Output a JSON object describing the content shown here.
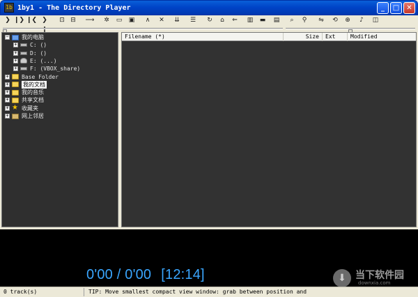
{
  "window": {
    "app_icon_text": "1b",
    "title": "1by1 - The Directory Player",
    "minimize": "_",
    "maximize": "□",
    "close": "✕"
  },
  "toolbar": {
    "buttons": [
      {
        "name": "play-icon",
        "glyph": "❯"
      },
      {
        "name": "play-pause-icon",
        "glyph": "❙❯"
      },
      {
        "name": "previous-icon",
        "glyph": "❙❮"
      },
      {
        "name": "next-icon",
        "glyph": "❯❙"
      },
      {
        "name": "open-file-icon",
        "glyph": "⊡"
      },
      {
        "name": "open-folder-icon",
        "glyph": "⊟"
      },
      {
        "name": "goto-icon",
        "glyph": "⟶"
      },
      {
        "name": "settings-icon",
        "glyph": "✲"
      },
      {
        "name": "view-compact-icon",
        "glyph": "▭"
      },
      {
        "name": "view-large-icon",
        "glyph": "▣"
      },
      {
        "name": "up-icon",
        "glyph": "∧"
      },
      {
        "name": "close-x-icon",
        "glyph": "✕"
      },
      {
        "name": "sort-icon",
        "glyph": "⇊"
      },
      {
        "name": "list-icon",
        "glyph": "☰"
      },
      {
        "name": "refresh-icon",
        "glyph": "↻"
      },
      {
        "name": "home-icon",
        "glyph": "⌂"
      },
      {
        "name": "back-icon",
        "glyph": "⇐"
      },
      {
        "name": "bookmark-icon",
        "glyph": "▥"
      },
      {
        "name": "bar-icon",
        "glyph": "▬"
      },
      {
        "name": "folder-icon",
        "glyph": "▤"
      },
      {
        "name": "search-icon",
        "glyph": "⌕"
      },
      {
        "name": "find-icon",
        "glyph": "⚲"
      },
      {
        "name": "equalizer-icon",
        "glyph": "⇋"
      },
      {
        "name": "loop-icon",
        "glyph": "⟲"
      },
      {
        "name": "download-icon",
        "glyph": "⊕"
      },
      {
        "name": "volume-icon",
        "glyph": "♪"
      },
      {
        "name": "panel-icon",
        "glyph": "◫"
      }
    ]
  },
  "sliders": {
    "seek_position": 0.0,
    "volume_position": 0.5
  },
  "tree": {
    "items": [
      {
        "label": "我的电脑",
        "expander": "−",
        "icon": "computer"
      },
      {
        "label": "C: ()",
        "expander": "+",
        "icon": "drive"
      },
      {
        "label": "D: ()",
        "expander": "+",
        "icon": "drive"
      },
      {
        "label": "E: (...)",
        "expander": "+",
        "icon": "person"
      },
      {
        "label": "F: (VBOX_share)",
        "expander": "+",
        "icon": "drive"
      },
      {
        "label": "Base Folder",
        "expander": "+",
        "icon": "folder"
      },
      {
        "label": "我的文档",
        "expander": "+",
        "icon": "folder",
        "selected": true
      },
      {
        "label": "我的音乐",
        "expander": "+",
        "icon": "folder"
      },
      {
        "label": "共享文档",
        "expander": "+",
        "icon": "folder"
      },
      {
        "label": "收藏夹",
        "expander": "+",
        "icon": "star"
      },
      {
        "label": "网上邻居",
        "expander": "+",
        "icon": "net"
      }
    ]
  },
  "file_list": {
    "columns": [
      "Filename (*)",
      "Size",
      "Ext",
      "Modified"
    ]
  },
  "player": {
    "time": "0'00 / 0'00",
    "clock": "[12:14]"
  },
  "watermark": {
    "icon": "⬇",
    "text": "当下软件园",
    "sub": "downxia.com"
  },
  "status": {
    "tracks": "0 track(s)",
    "tip": "TIP: Move smallest compact view window: grab between position and"
  }
}
